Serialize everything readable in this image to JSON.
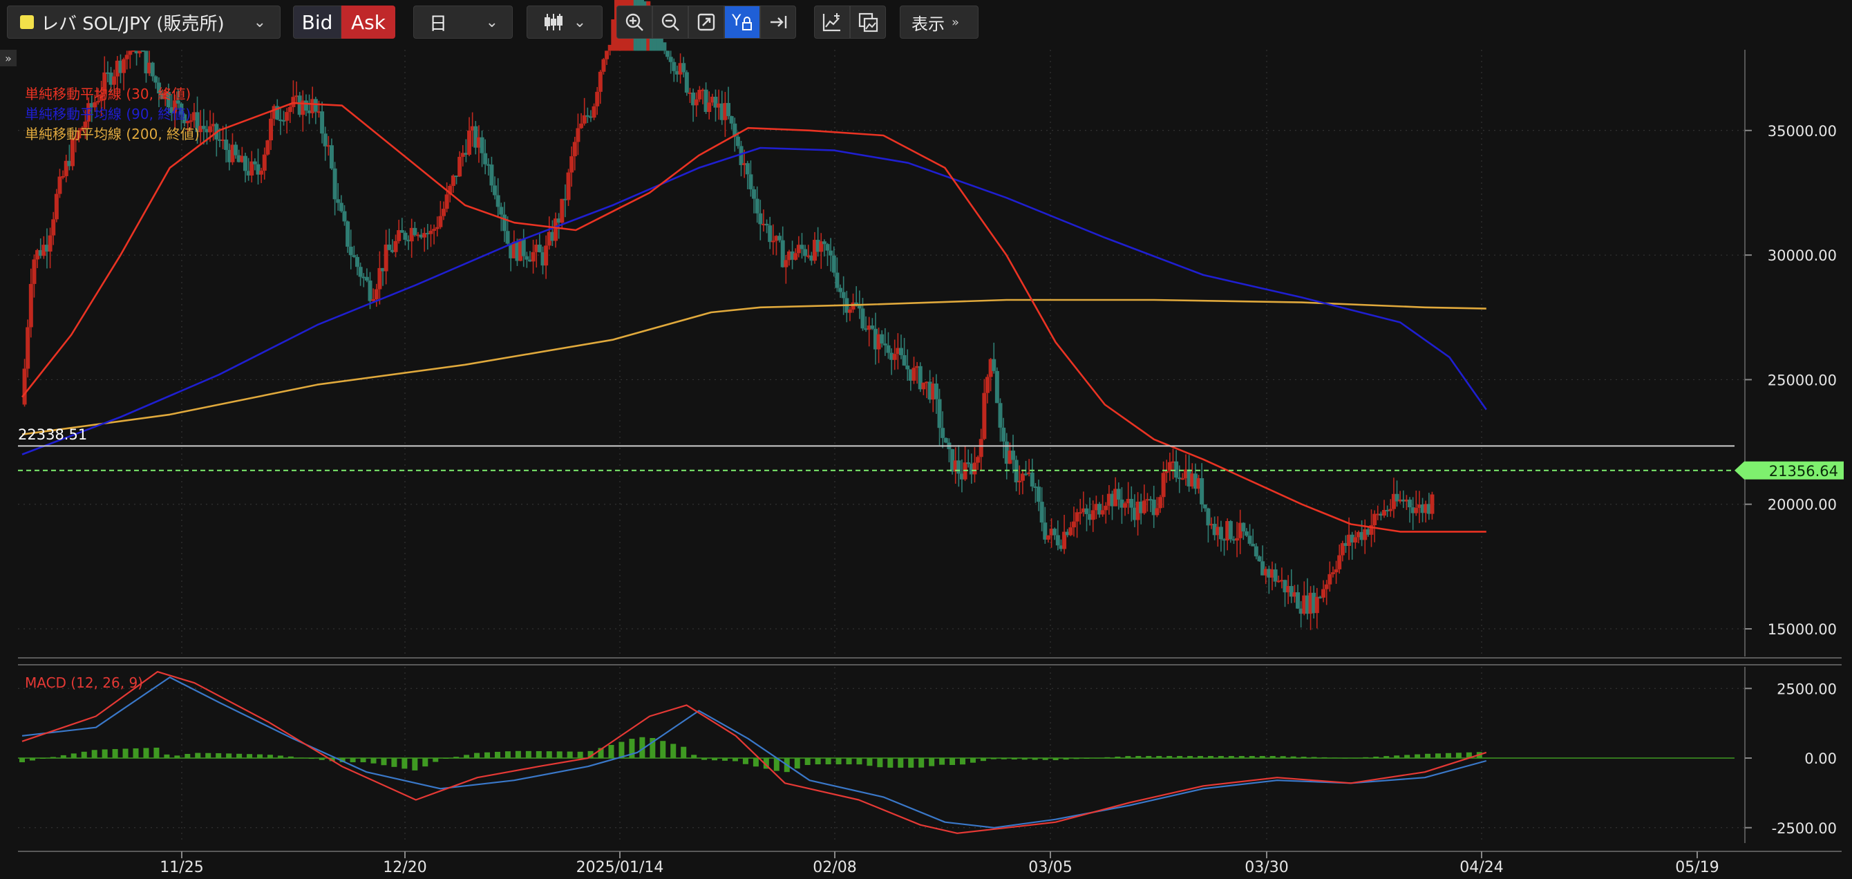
{
  "toolbar": {
    "symbol": "レバ SOL/JPY (販売所)",
    "bid": "Bid",
    "ask": "Ask",
    "timeframe": "日",
    "display": "表示"
  },
  "colors": {
    "bull": "#c0281e",
    "bear": "#2f7d73",
    "sma30": "#ea3323",
    "sma90": "#1f1fd0",
    "sma200": "#e0a93c",
    "macd": "#e53935",
    "signal": "#3a78c9",
    "hist": "#3f9a22",
    "current": "#7ef06e"
  },
  "chart_data": [
    {
      "type": "candlestick",
      "title": "",
      "x_ticks": [
        "11/25",
        "12/20",
        "2025/01/14",
        "02/08",
        "03/05",
        "03/30",
        "04/24",
        "05/19"
      ],
      "y_ticks": [
        "35000.00",
        "30000.00",
        "25000.00",
        "20000.00",
        "15000.00"
      ],
      "ylim": [
        13500,
        37500
      ],
      "horizontal_line": {
        "label": "22338.51",
        "value": 22338.51
      },
      "current_price": {
        "label": "21356.64",
        "value": 21356.64
      },
      "legend": [
        "単純移動平均線 (30, 終値)",
        "単純移動平均線 (90, 終値)",
        "単純移動平均線 (200, 終値)"
      ],
      "sma30": [
        [
          0,
          24300
        ],
        [
          20,
          26800
        ],
        [
          40,
          30000
        ],
        [
          60,
          33500
        ],
        [
          80,
          35000
        ],
        [
          110,
          36100
        ],
        [
          130,
          36000
        ],
        [
          155,
          34000
        ],
        [
          180,
          32000
        ],
        [
          200,
          31300
        ],
        [
          225,
          31000
        ],
        [
          255,
          32500
        ],
        [
          275,
          34000
        ],
        [
          295,
          35100
        ],
        [
          320,
          35000
        ],
        [
          350,
          34800
        ],
        [
          375,
          33500
        ],
        [
          400,
          30000
        ],
        [
          420,
          26500
        ],
        [
          440,
          24000
        ],
        [
          460,
          22600
        ],
        [
          480,
          21800
        ],
        [
          500,
          20900
        ],
        [
          520,
          20000
        ],
        [
          540,
          19200
        ],
        [
          560,
          18900
        ],
        [
          580,
          18900
        ],
        [
          595,
          18900
        ]
      ],
      "sma90": [
        [
          0,
          22000
        ],
        [
          40,
          23500
        ],
        [
          80,
          25200
        ],
        [
          120,
          27200
        ],
        [
          160,
          28800
        ],
        [
          200,
          30500
        ],
        [
          240,
          32000
        ],
        [
          275,
          33500
        ],
        [
          300,
          34300
        ],
        [
          330,
          34200
        ],
        [
          360,
          33700
        ],
        [
          400,
          32300
        ],
        [
          440,
          30700
        ],
        [
          480,
          29200
        ],
        [
          520,
          28300
        ],
        [
          560,
          27300
        ],
        [
          580,
          25900
        ],
        [
          595,
          23800
        ]
      ],
      "sma200": [
        [
          0,
          22800
        ],
        [
          60,
          23600
        ],
        [
          120,
          24800
        ],
        [
          180,
          25600
        ],
        [
          240,
          26600
        ],
        [
          280,
          27700
        ],
        [
          300,
          27900
        ],
        [
          340,
          28000
        ],
        [
          400,
          28200
        ],
        [
          460,
          28200
        ],
        [
          520,
          28100
        ],
        [
          570,
          27900
        ],
        [
          595,
          27850
        ]
      ],
      "candles_start_day": 0
    },
    {
      "type": "macd",
      "title": "MACD (12, 26, 9)",
      "y_ticks": [
        "2500.00",
        "0.00",
        "-2500.00"
      ],
      "ylim": [
        -3300,
        3700
      ],
      "macd": [
        [
          0,
          600
        ],
        [
          30,
          1500
        ],
        [
          55,
          3100
        ],
        [
          70,
          2700
        ],
        [
          100,
          1300
        ],
        [
          130,
          -300
        ],
        [
          160,
          -1500
        ],
        [
          185,
          -700
        ],
        [
          210,
          -300
        ],
        [
          230,
          0
        ],
        [
          255,
          1500
        ],
        [
          270,
          1900
        ],
        [
          290,
          800
        ],
        [
          310,
          -900
        ],
        [
          340,
          -1500
        ],
        [
          365,
          -2400
        ],
        [
          380,
          -2700
        ],
        [
          400,
          -2500
        ],
        [
          420,
          -2300
        ],
        [
          450,
          -1600
        ],
        [
          480,
          -1000
        ],
        [
          510,
          -700
        ],
        [
          540,
          -900
        ],
        [
          570,
          -500
        ],
        [
          595,
          200
        ]
      ],
      "signal": [
        [
          0,
          800
        ],
        [
          30,
          1100
        ],
        [
          60,
          2900
        ],
        [
          80,
          2000
        ],
        [
          110,
          700
        ],
        [
          140,
          -500
        ],
        [
          170,
          -1100
        ],
        [
          200,
          -800
        ],
        [
          230,
          -300
        ],
        [
          250,
          200
        ],
        [
          275,
          1700
        ],
        [
          295,
          700
        ],
        [
          320,
          -800
        ],
        [
          350,
          -1400
        ],
        [
          375,
          -2300
        ],
        [
          395,
          -2500
        ],
        [
          420,
          -2200
        ],
        [
          450,
          -1700
        ],
        [
          480,
          -1100
        ],
        [
          510,
          -800
        ],
        [
          540,
          -900
        ],
        [
          570,
          -700
        ],
        [
          595,
          -100
        ]
      ]
    }
  ]
}
